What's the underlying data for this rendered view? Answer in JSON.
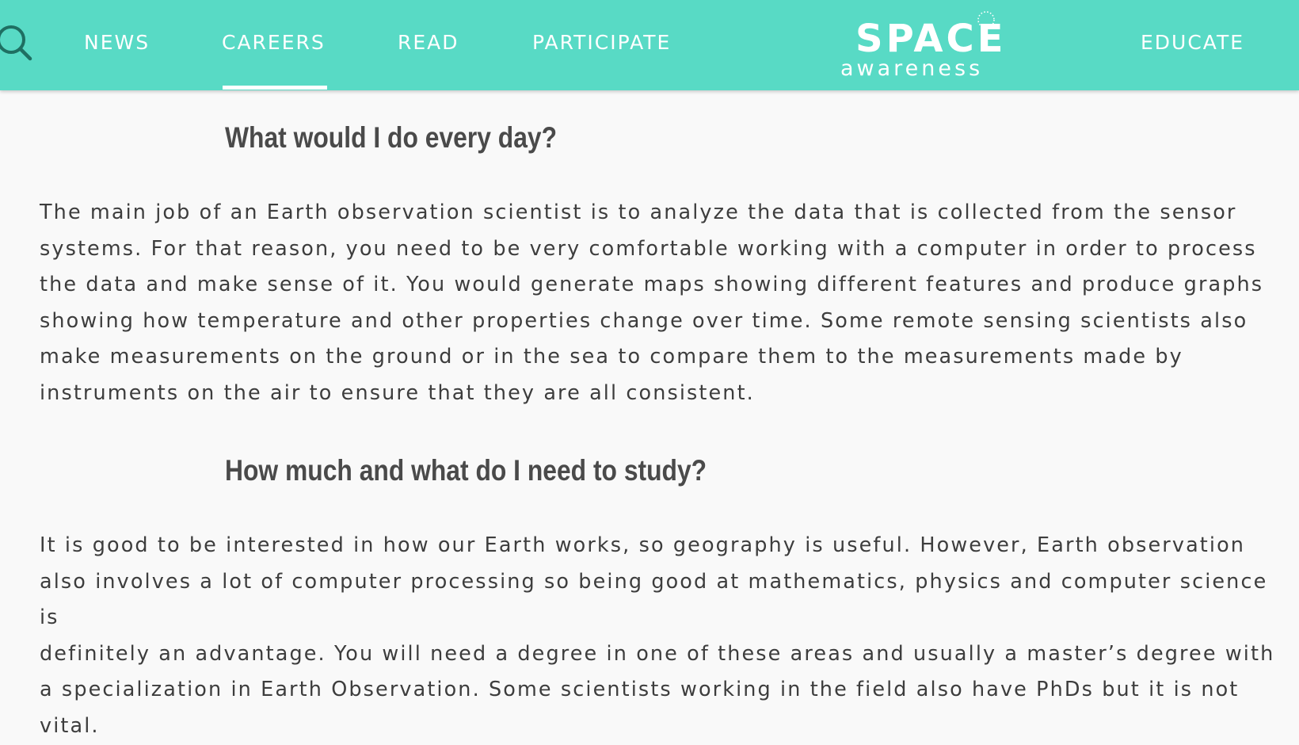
{
  "header": {
    "search_icon": "search-icon",
    "nav": {
      "news": "NEWS",
      "careers": "CAREERS",
      "read": "READ",
      "participate": "PARTICIPATE",
      "educate": "EDUCATE"
    },
    "active_item": "CAREERS",
    "logo": {
      "line1": "SPACE",
      "line2": "awareness"
    },
    "bar_color": "#58dac5",
    "text_color": "#ffffff"
  },
  "article": {
    "section1": {
      "heading": "What would I do every day?",
      "body": "The main job of an Earth observation scientist is to analyze the data that is collected from the sensor\nsystems. For that reason, you need to be very comfortable working with a computer in order to process\nthe data and make sense of it.  You would generate maps showing different features and produce graphs\nshowing how temperature and other properties change over time. Some remote sensing scientists also\nmake measurements on the ground or in the sea to compare them to the measurements made by\ninstruments on the air to ensure that they are all consistent."
    },
    "section2": {
      "heading": "How much and what do I need to study?",
      "body": "It is good to be interested in how our Earth works, so geography is useful. However, Earth observation\nalso involves a lot of computer processing so being good at mathematics, physics and computer science is\ndefinitely an advantage. You will need a degree in one of these areas and usually a master’s degree with\na specialization in Earth Observation. Some scientists working in the field also have PhDs but it is not\nvital."
    }
  }
}
